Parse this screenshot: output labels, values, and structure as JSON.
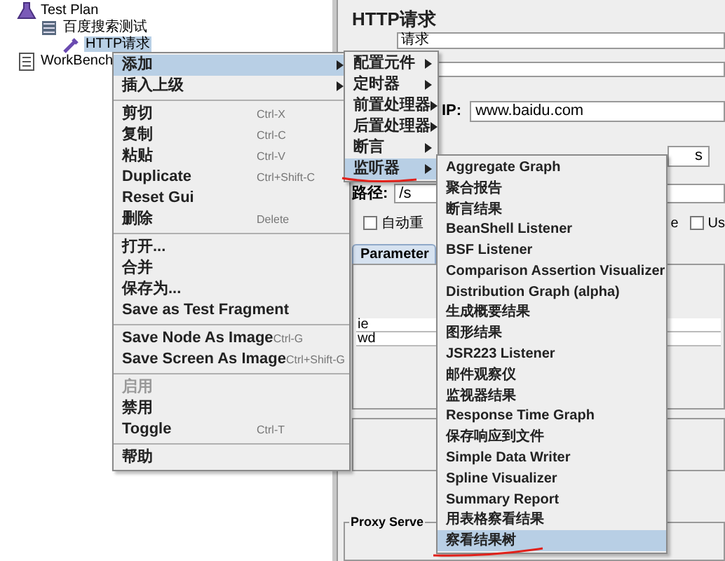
{
  "tree": [
    {
      "label": "Test Plan",
      "kind": "plan",
      "selected": false,
      "children": [
        {
          "label": "百度搜索测试",
          "kind": "thread_group",
          "selected": false,
          "children": [
            {
              "label": "HTTP请求",
              "kind": "sampler",
              "selected": true
            }
          ]
        }
      ]
    },
    {
      "label": "WorkBench",
      "kind": "workbench",
      "selected": false
    }
  ],
  "editor": {
    "title": "HTTP请求",
    "name_value": "请求",
    "server_label": "IP:",
    "server_value": "www.baidu.com",
    "protocol_value": "s",
    "path_label": "路径:",
    "path_value": "/s",
    "checkboxes": [
      {
        "label": "自动重",
        "checked": false,
        "kind": "box"
      },
      {
        "label": "e",
        "kind": "text"
      },
      {
        "label": "Us",
        "checked": false,
        "kind": "box"
      }
    ],
    "tab": "Parameter",
    "parameters": [
      "ie",
      "wd"
    ],
    "proxy_legend": "Proxy Serve"
  },
  "context_menu": {
    "items": [
      {
        "kind": "item",
        "label": "添加",
        "submenu": true,
        "selected": true
      },
      {
        "kind": "item",
        "label": "插入上级",
        "submenu": true,
        "selected": false
      },
      {
        "kind": "separator"
      },
      {
        "kind": "item",
        "label": "剪切",
        "shortcut": "Ctrl-X",
        "selected": false
      },
      {
        "kind": "item",
        "label": "复制",
        "shortcut": "Ctrl-C",
        "selected": false
      },
      {
        "kind": "item",
        "label": "粘贴",
        "shortcut": "Ctrl-V",
        "selected": false
      },
      {
        "kind": "item",
        "label": "Duplicate",
        "shortcut": "Ctrl+Shift-C",
        "selected": false
      },
      {
        "kind": "item",
        "label": "Reset Gui",
        "selected": false
      },
      {
        "kind": "item",
        "label": "删除",
        "shortcut": "Delete",
        "selected": false
      },
      {
        "kind": "separator"
      },
      {
        "kind": "item",
        "label": "打开...",
        "selected": false
      },
      {
        "kind": "item",
        "label": "合并",
        "selected": false
      },
      {
        "kind": "item",
        "label": "保存为...",
        "selected": false
      },
      {
        "kind": "item",
        "label": "Save as Test Fragment",
        "selected": false
      },
      {
        "kind": "separator"
      },
      {
        "kind": "item",
        "label": "Save Node As Image",
        "shortcut": "Ctrl-G",
        "selected": false
      },
      {
        "kind": "item",
        "label": "Save Screen As Image",
        "shortcut": "Ctrl+Shift-G",
        "selected": false
      },
      {
        "kind": "separator"
      },
      {
        "kind": "item",
        "label": "启用",
        "disabled": true,
        "selected": false
      },
      {
        "kind": "item",
        "label": "禁用",
        "selected": false
      },
      {
        "kind": "item",
        "label": "Toggle",
        "shortcut": "Ctrl-T",
        "selected": false
      },
      {
        "kind": "separator"
      },
      {
        "kind": "item",
        "label": "帮助",
        "selected": false
      }
    ]
  },
  "add_submenu": {
    "items": [
      {
        "kind": "item",
        "label": "配置元件",
        "submenu": true,
        "selected": false
      },
      {
        "kind": "item",
        "label": "定时器",
        "submenu": true,
        "selected": false
      },
      {
        "kind": "item",
        "label": "前置处理器",
        "submenu": true,
        "selected": false
      },
      {
        "kind": "item",
        "label": "后置处理器",
        "submenu": true,
        "selected": false
      },
      {
        "kind": "item",
        "label": "断言",
        "submenu": true,
        "selected": false
      },
      {
        "kind": "item",
        "label": "监听器",
        "submenu": true,
        "selected": true
      }
    ]
  },
  "listener_submenu": {
    "items": [
      {
        "kind": "item",
        "label": "Aggregate Graph",
        "selected": false
      },
      {
        "kind": "item",
        "label": "聚合报告",
        "selected": false
      },
      {
        "kind": "item",
        "label": "断言结果",
        "selected": false
      },
      {
        "kind": "item",
        "label": "BeanShell Listener",
        "selected": false
      },
      {
        "kind": "item",
        "label": "BSF Listener",
        "selected": false
      },
      {
        "kind": "item",
        "label": "Comparison Assertion Visualizer",
        "selected": false
      },
      {
        "kind": "item",
        "label": "Distribution Graph (alpha)",
        "selected": false
      },
      {
        "kind": "item",
        "label": "生成概要结果",
        "selected": false
      },
      {
        "kind": "item",
        "label": "图形结果",
        "selected": false
      },
      {
        "kind": "item",
        "label": "JSR223 Listener",
        "selected": false
      },
      {
        "kind": "item",
        "label": "邮件观察仪",
        "selected": false
      },
      {
        "kind": "item",
        "label": "监视器结果",
        "selected": false
      },
      {
        "kind": "item",
        "label": "Response Time Graph",
        "selected": false
      },
      {
        "kind": "item",
        "label": "保存响应到文件",
        "selected": false
      },
      {
        "kind": "item",
        "label": "Simple Data Writer",
        "selected": false
      },
      {
        "kind": "item",
        "label": "Spline Visualizer",
        "selected": false
      },
      {
        "kind": "item",
        "label": "Summary Report",
        "selected": false
      },
      {
        "kind": "item",
        "label": "用表格察看结果",
        "selected": false
      },
      {
        "kind": "item",
        "label": "察看结果树",
        "selected": true
      }
    ]
  }
}
